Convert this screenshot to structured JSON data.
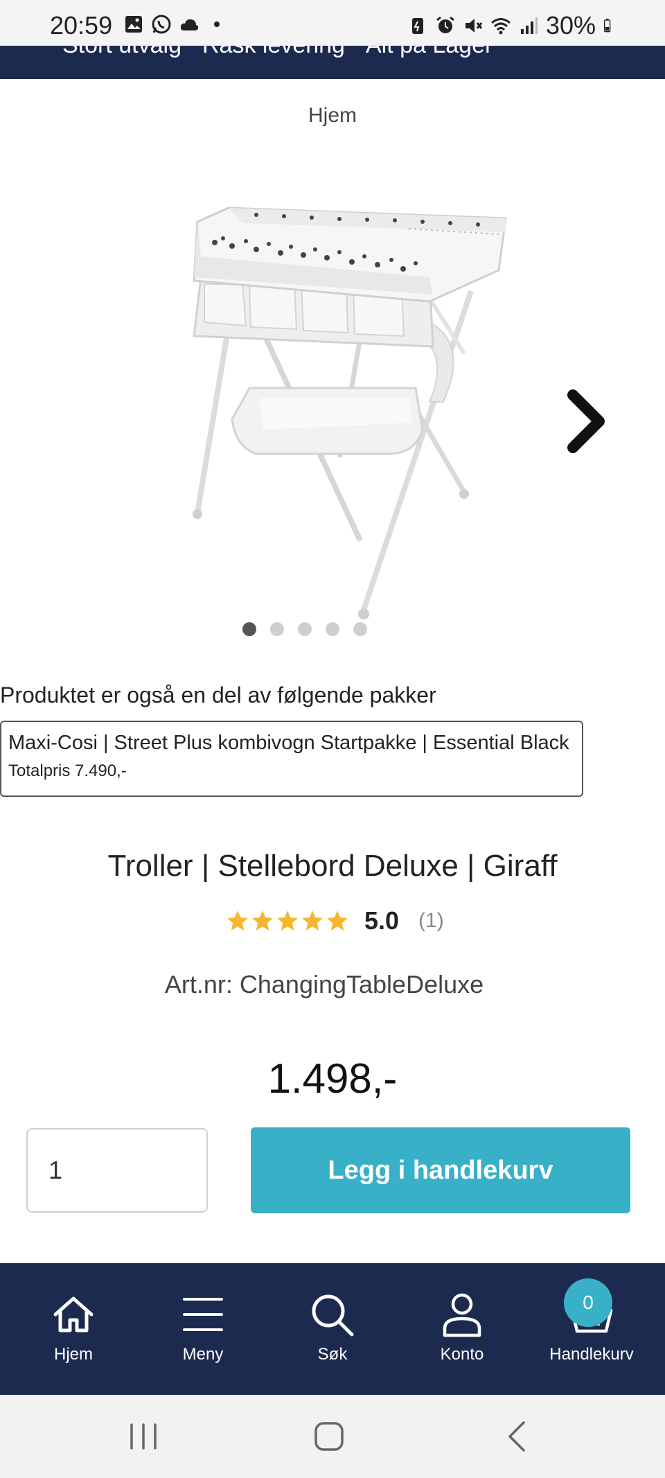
{
  "status_bar": {
    "time": "20:59",
    "battery": "30%",
    "left_icons": [
      "image-icon",
      "whatsapp-icon",
      "cloud-icon",
      "dot-icon"
    ],
    "right_icons": [
      "battery-saver-icon",
      "alarm-icon",
      "mute-icon",
      "wifi-icon",
      "signal-icon",
      "battery-icon"
    ]
  },
  "promo": {
    "items": [
      "Stort utvalg",
      "Rask levering",
      "Alt på Lager"
    ]
  },
  "breadcrumb": {
    "home": "Hjem"
  },
  "gallery": {
    "image_count": 5,
    "active_index": 0
  },
  "packages": {
    "heading": "Produktet er også en del av følgende pakker",
    "items": [
      {
        "title": "Maxi-Cosi | Street Plus kombivogn Startpakke | Essential Black",
        "price": "Totalpris 7.490,-"
      }
    ]
  },
  "product": {
    "title": "Troller | Stellebord Deluxe | Giraff",
    "rating_value": "5.0",
    "rating_count": "(1)",
    "stars": 5,
    "art_nr": "Art.nr: ChangingTableDeluxe",
    "price": "1.498,-",
    "quantity": "1",
    "add_to_cart_label": "Legg i handlekurv"
  },
  "bottom_nav": {
    "items": [
      {
        "label": "Hjem",
        "icon": "home-icon"
      },
      {
        "label": "Meny",
        "icon": "menu-icon"
      },
      {
        "label": "Søk",
        "icon": "search-icon"
      },
      {
        "label": "Konto",
        "icon": "user-icon"
      },
      {
        "label": "Handlekurv",
        "icon": "basket-icon"
      }
    ],
    "cart_count": "0"
  },
  "colors": {
    "navy": "#1c2a4f",
    "accent": "#38b0c8",
    "star": "#f5b731"
  }
}
